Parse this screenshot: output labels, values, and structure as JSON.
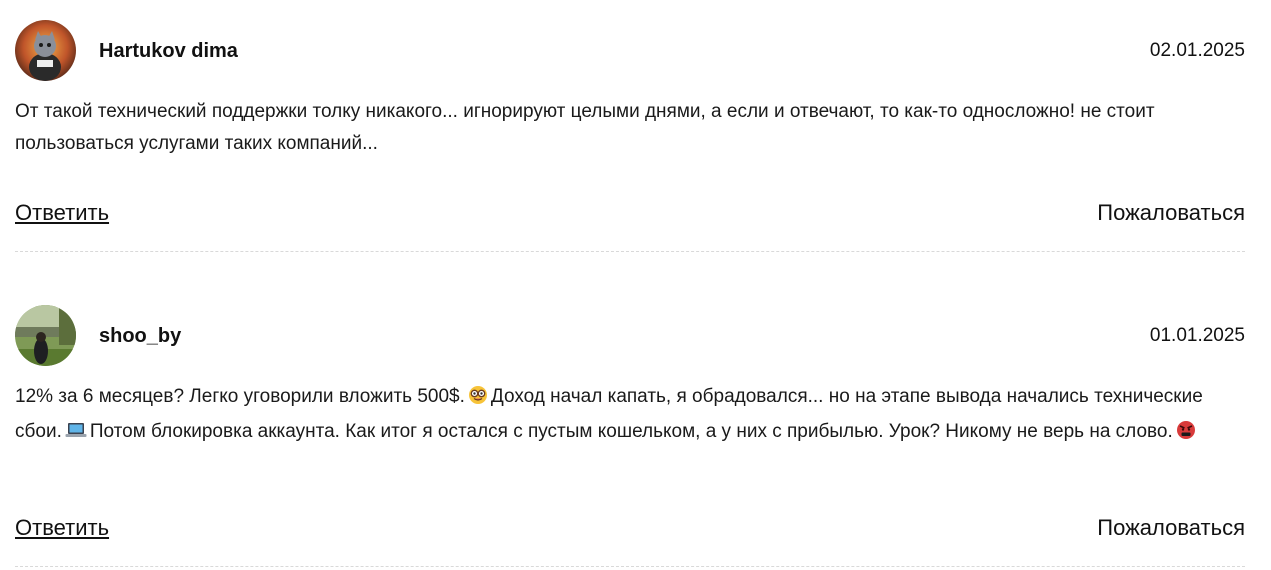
{
  "comments": [
    {
      "author": "Hartukov dima",
      "date": "02.01.2025",
      "text": "От такой технический поддержки толку никакого... игнорируют целыми днями, а если и отвечают, то как-то односложно! не стоит пользоваться услугами таких компаний...",
      "reply_label": "Ответить",
      "report_label": "Пожаловаться"
    },
    {
      "author": "shoo_by",
      "date": "01.01.2025",
      "text_parts": [
        "12% за 6 месяцев? Легко уговорили вложить 500$.",
        "Доход начал капать, я обрадовался... но на этапе вывода начались технические сбои.",
        "Потом блокировка аккаунта. Как итог я остался с пустым кошельком, а у них с прибылью. Урок? Никому не верь на слово."
      ],
      "emojis": [
        "nerd-face-emoji",
        "laptop-emoji",
        "angry-face-emoji"
      ],
      "reply_label": "Ответить",
      "report_label": "Пожаловаться"
    }
  ]
}
